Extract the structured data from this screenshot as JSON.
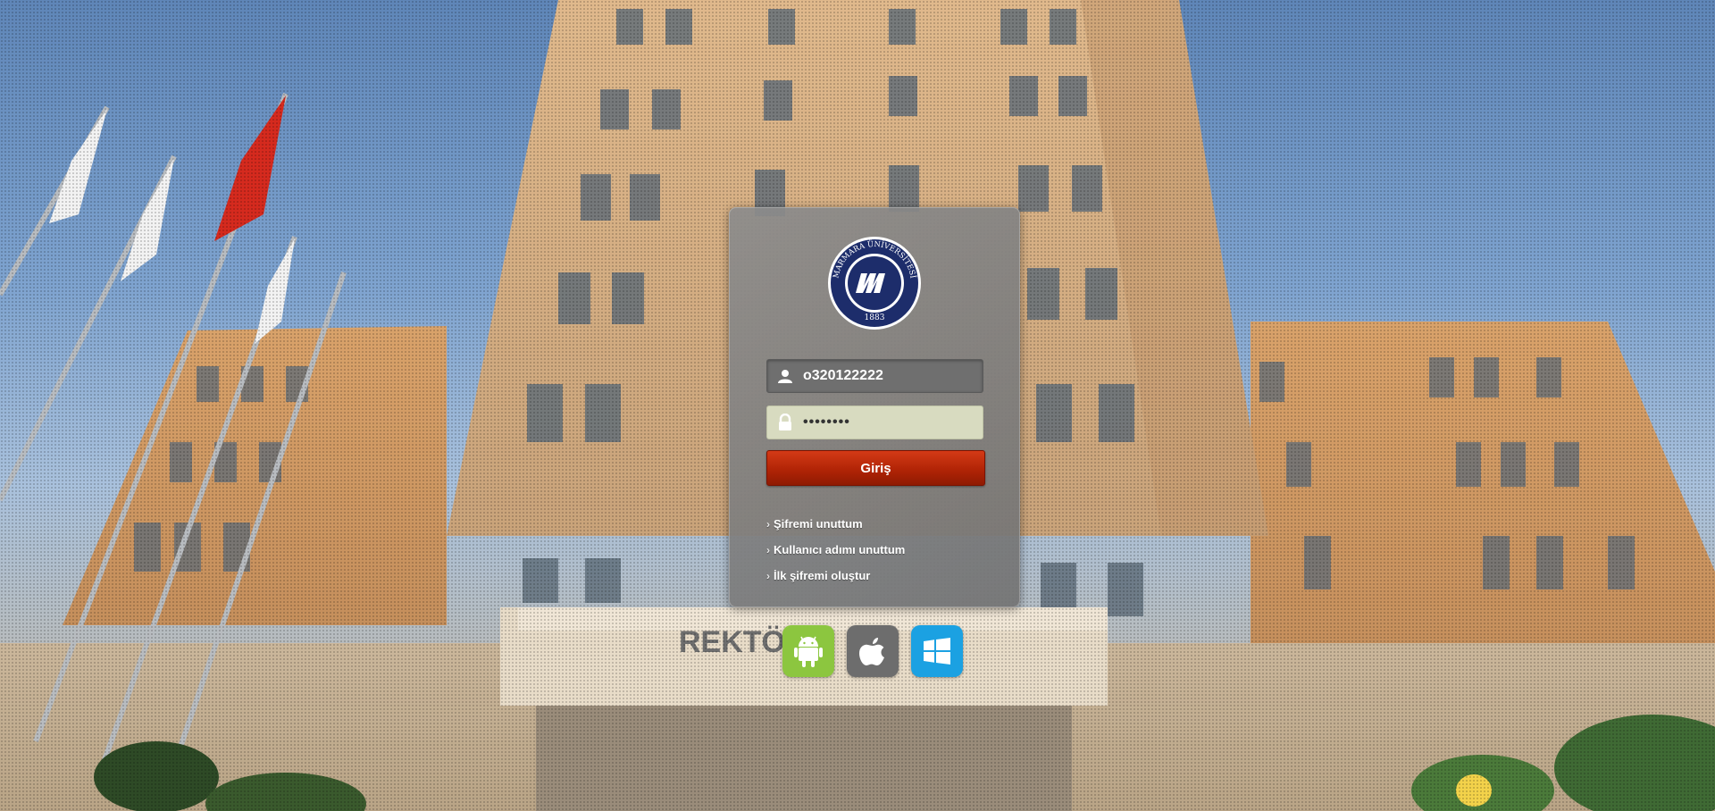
{
  "login": {
    "username_value": "o320122222",
    "password_value": "••••••••",
    "submit_label": "Giriş"
  },
  "links": {
    "forgot_password": "Şifremi unuttum",
    "forgot_username": "Kullanıcı adımı unuttum",
    "create_first_password": "İlk şifremi oluştur"
  },
  "logo": {
    "name": "MARMARA ÜNİVERSİTESİ",
    "year": "1883"
  },
  "building_sign": "REKTÖ",
  "apps": [
    {
      "name": "android-icon",
      "color": "#8cc63f"
    },
    {
      "name": "apple-icon",
      "color": "#6d6d6d"
    },
    {
      "name": "windows-icon",
      "color": "#1ba1e2"
    }
  ],
  "colors": {
    "submit_button": "#b12406",
    "university_blue": "#1d2d6b"
  }
}
